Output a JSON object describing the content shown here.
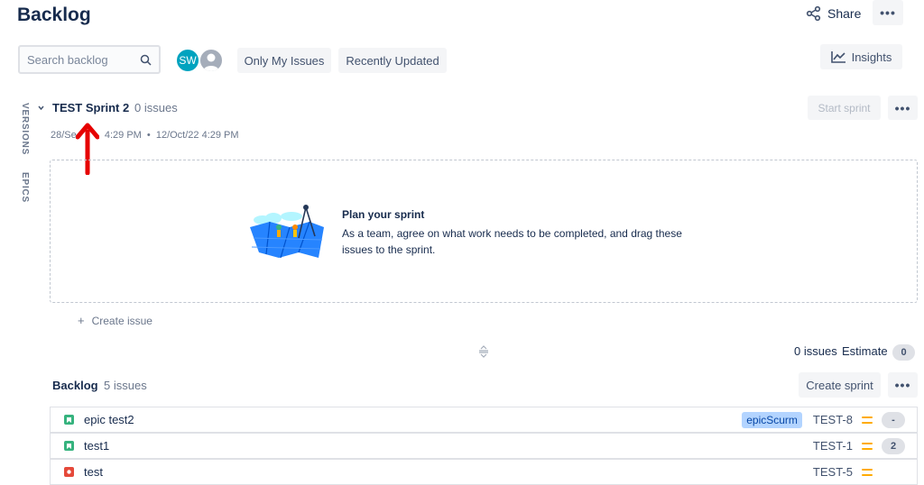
{
  "header": {
    "title": "Backlog",
    "share_label": "Share",
    "more_label": "•••"
  },
  "toolbar": {
    "search_placeholder": "Search backlog",
    "avatar_initials": "SW",
    "filters": [
      "Only My Issues",
      "Recently Updated"
    ],
    "insights_label": "Insights"
  },
  "side_tabs": [
    "VERSIONS",
    "EPICS"
  ],
  "sprint": {
    "name": "TEST Sprint 2",
    "count": "0 issues",
    "start_label": "Start sprint",
    "more_label": "•••",
    "dates_start": "28/Se",
    "dates_mid": "4:29 PM",
    "dates_sep": "•",
    "dates_end": "12/Oct/22 4:29 PM",
    "empty_title": "Plan your sprint",
    "empty_body": "As a team, agree on what work needs to be completed, and drag these issues to the sprint.",
    "create_issue": "Create issue",
    "summary_issues": "0 issues",
    "summary_estimate_label": "Estimate",
    "summary_estimate_value": "0"
  },
  "backlog": {
    "name": "Backlog",
    "count": "5 issues",
    "create_sprint_label": "Create sprint",
    "more_label": "•••",
    "issues": [
      {
        "type": "story",
        "summary": "epic test2",
        "epic": "epicScurm",
        "key": "TEST-8",
        "estimate": "-"
      },
      {
        "type": "story",
        "summary": "test1",
        "epic": "",
        "key": "TEST-1",
        "estimate": "2"
      },
      {
        "type": "bug",
        "summary": "test",
        "epic": "",
        "key": "TEST-5",
        "estimate": ""
      }
    ]
  },
  "colors": {
    "story": "#36B37E",
    "bug": "#E5493A",
    "priority_medium": "#FFAB00",
    "annotation_arrow": "#E60000",
    "avatar": "#00A3BF"
  },
  "icons": [
    "share-icon",
    "search-icon",
    "user-icon",
    "insights-chart-icon",
    "chevron-down-icon",
    "plus-icon",
    "drag-handle-icon",
    "story-icon",
    "bug-icon",
    "priority-medium-icon",
    "annotation-arrow-icon",
    "sprint-illustration"
  ]
}
